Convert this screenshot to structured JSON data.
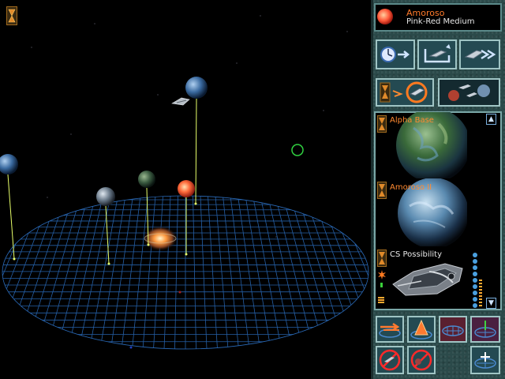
{
  "star": {
    "name": "Amoroso",
    "class": "Pink-Red Medium",
    "color": "#ff6a4a"
  },
  "colors": {
    "grid": "#2a6ab8",
    "stalk": "#e8ff6a",
    "label_orange": "#ff8a30",
    "panel_bg": "#2b4a4a"
  },
  "action_buttons": [
    {
      "name": "time-advance-icon"
    },
    {
      "name": "move-ship-icon"
    },
    {
      "name": "fast-forward-ship-icon"
    }
  ],
  "view_buttons": [
    {
      "name": "hourglass-target-icon"
    },
    {
      "name": "planets-view-icon"
    }
  ],
  "list": {
    "scroll_up": "▲",
    "scroll_down": "▼",
    "items": [
      {
        "label": "Alpha Base",
        "kind": "planet"
      },
      {
        "label": "Amoroso II",
        "kind": "planet"
      },
      {
        "label": "CS Possibility",
        "kind": "ship"
      }
    ]
  },
  "bottom_buttons": [
    {
      "name": "rotate-view-icon"
    },
    {
      "name": "zoom-view-icon"
    },
    {
      "name": "grid-toggle-icon"
    },
    {
      "name": "grid-axis-icon"
    },
    {
      "name": "no-orbits-icon"
    },
    {
      "name": "no-ships-icon"
    },
    {
      "name": "grid-center-icon"
    }
  ]
}
